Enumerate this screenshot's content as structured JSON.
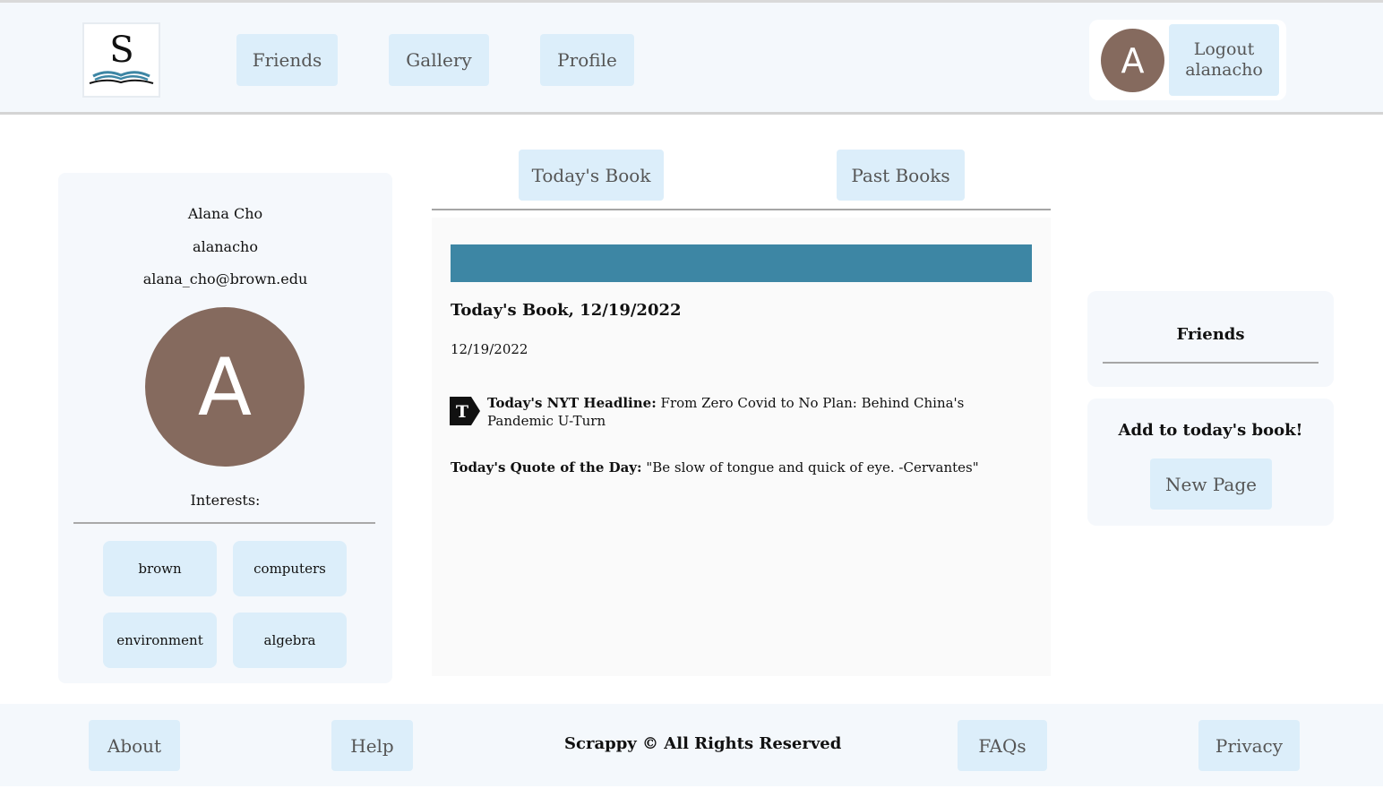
{
  "header": {
    "logo_letter": "S",
    "nav": [
      "Friends",
      "Gallery",
      "Profile"
    ],
    "avatar_letter": "A",
    "logout_label": "Logout",
    "logout_username": "alanacho"
  },
  "profile": {
    "name": "Alana Cho",
    "username": "alanacho",
    "email": "alana_cho@brown.edu",
    "avatar_letter": "A",
    "interests_label": "Interests:",
    "interests": [
      "brown",
      "computers",
      "environment",
      "algebra"
    ]
  },
  "tabs": [
    "Today's Book",
    "Past Books"
  ],
  "book": {
    "title": "Today's Book, 12/19/2022",
    "date": "12/19/2022",
    "headline_label": "Today's NYT Headline:",
    "headline_text": "From Zero Covid to No Plan: Behind China's Pandemic U-Turn",
    "quote_label": "Today's Quote of the Day:",
    "quote_text": "\"Be slow of tongue and quick of eye. -Cervantes\""
  },
  "sidebar": {
    "friends_title": "Friends",
    "add_title": "Add to today's book!",
    "new_page_label": "New Page"
  },
  "footer": {
    "about": "About",
    "help": "Help",
    "copyright": "Scrappy © All Rights Reserved",
    "faqs": "FAQs",
    "privacy": "Privacy"
  },
  "colors": {
    "accent_bar": "#3d86a4",
    "button_bg": "#dceefa",
    "avatar_bg": "#856a5e",
    "panel_bg": "#f5f8fc"
  },
  "icons": [
    "book-logo-icon",
    "nyt-logo-icon"
  ]
}
